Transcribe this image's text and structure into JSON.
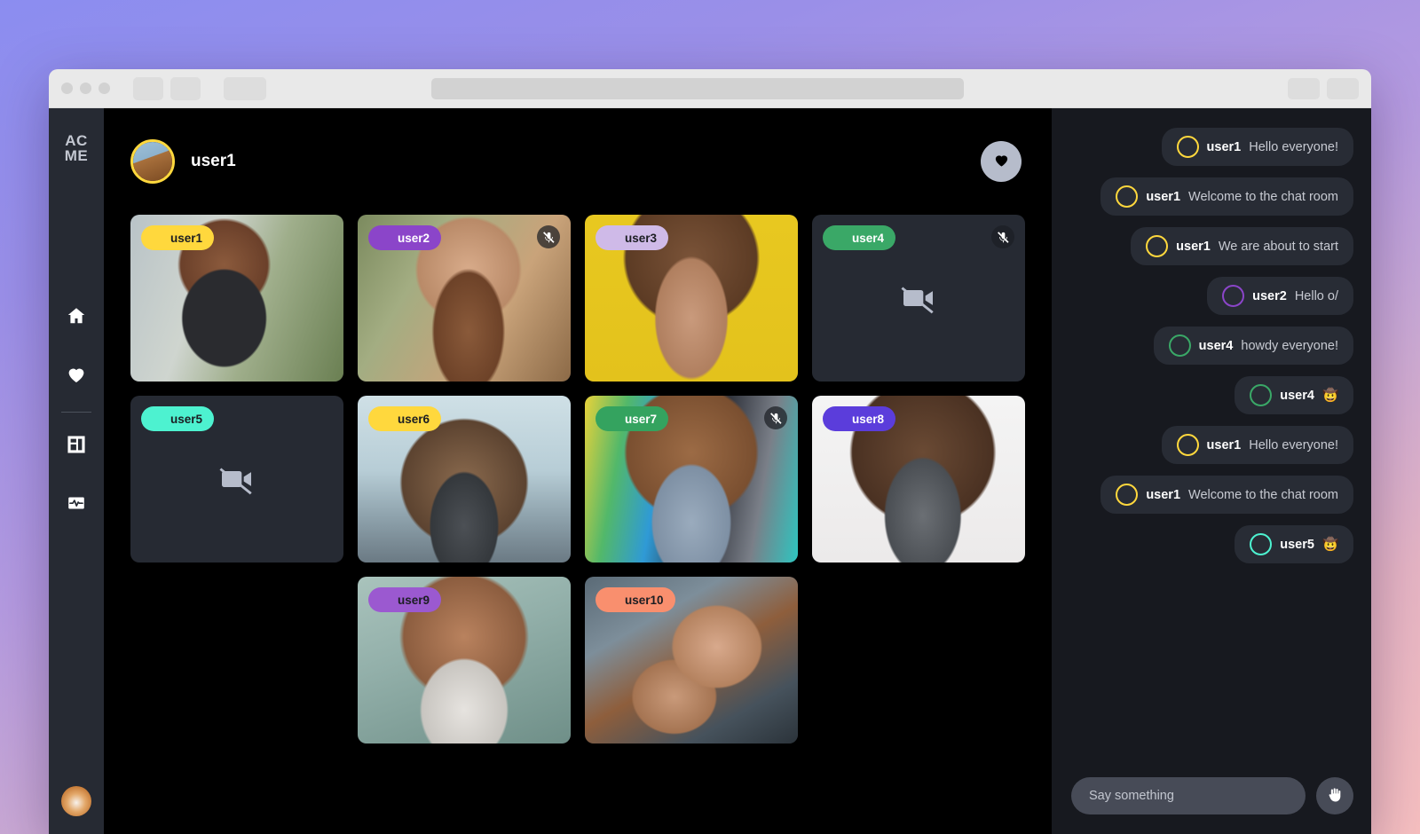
{
  "browser": {
    "dots": 3,
    "tabs": 3,
    "right_buttons": 2
  },
  "sidebar": {
    "logo_line1": "AC",
    "logo_line2": "ME",
    "items": [
      {
        "name": "home",
        "icon": "home-icon"
      },
      {
        "name": "favorites",
        "icon": "heart-icon"
      },
      {
        "name": "layout",
        "icon": "grid-layout-icon"
      },
      {
        "name": "activity",
        "icon": "activity-pulse-icon"
      }
    ],
    "avatar": {
      "alt": "shiba",
      "art": "av-shiba"
    }
  },
  "header": {
    "host_name": "user1",
    "host_avatar": {
      "art": "av-horse",
      "ring": "#ffd83d"
    },
    "action_icon": "heart-icon"
  },
  "tiles": [
    {
      "name": "user1",
      "badge_bg": "#ffd83d",
      "badge_fg": "#1b1d22",
      "avatar_art": "av-horse",
      "muted": false,
      "camera_off": false,
      "photo": "ph1"
    },
    {
      "name": "user2",
      "badge_bg": "#8b45c9",
      "badge_fg": "#ffffff",
      "avatar_art": "av-dog",
      "muted": true,
      "camera_off": false,
      "photo": "ph2"
    },
    {
      "name": "user3",
      "badge_bg": "#cfbae8",
      "badge_fg": "#1b1d22",
      "avatar_art": "av-horse2",
      "muted": false,
      "camera_off": false,
      "photo": "ph3"
    },
    {
      "name": "user4",
      "badge_bg": "#3aa867",
      "badge_fg": "#ffffff",
      "avatar_art": "av-parrot",
      "muted": true,
      "camera_off": true,
      "photo": ""
    },
    {
      "name": "user5",
      "badge_bg": "#4df2d0",
      "badge_fg": "#1b1d22",
      "avatar_art": "av-deer",
      "muted": false,
      "camera_off": true,
      "photo": ""
    },
    {
      "name": "user6",
      "badge_bg": "#ffd83d",
      "badge_fg": "#1b1d22",
      "avatar_art": "av-goat",
      "muted": false,
      "camera_off": false,
      "photo": "ph6"
    },
    {
      "name": "user7",
      "badge_bg": "#34a35f",
      "badge_fg": "#ffffff",
      "avatar_art": "av-shiba",
      "muted": true,
      "camera_off": false,
      "photo": "ph7"
    },
    {
      "name": "user8",
      "badge_bg": "#5b3ddb",
      "badge_fg": "#ffffff",
      "avatar_art": "av-shiba",
      "muted": false,
      "camera_off": false,
      "photo": "ph8"
    },
    {
      "name": "user9",
      "badge_bg": "#9b59d0",
      "badge_fg": "#1b1d22",
      "avatar_art": "av-bear",
      "muted": false,
      "camera_off": false,
      "photo": "ph9"
    },
    {
      "name": "user10",
      "badge_bg": "#f98f6e",
      "badge_fg": "#1b1d22",
      "avatar_art": "av-hedge",
      "muted": false,
      "camera_off": false,
      "photo": "ph10"
    }
  ],
  "chat": {
    "messages": [
      {
        "user": "user1",
        "text": "Hello everyone!",
        "avatar_art": "av-horse",
        "ring": "#ffd83d"
      },
      {
        "user": "user1",
        "text": "Welcome to the chat room",
        "avatar_art": "av-horse",
        "ring": "#ffd83d"
      },
      {
        "user": "user1",
        "text": "We are about to start",
        "avatar_art": "av-horse",
        "ring": "#ffd83d"
      },
      {
        "user": "user2",
        "text": "Hello o/",
        "avatar_art": "av-dog",
        "ring": "#8b45c9"
      },
      {
        "user": "user4",
        "text": "howdy everyone!",
        "avatar_art": "av-parrot",
        "ring": "#3aa867"
      },
      {
        "user": "user4",
        "text": "🤠",
        "avatar_art": "av-parrot",
        "ring": "#3aa867"
      },
      {
        "user": "user1",
        "text": "Hello everyone!",
        "avatar_art": "av-horse",
        "ring": "#ffd83d"
      },
      {
        "user": "user1",
        "text": "Welcome to the chat room",
        "avatar_art": "av-horse",
        "ring": "#ffd83d"
      },
      {
        "user": "user5",
        "text": "🤠",
        "avatar_art": "av-deer",
        "ring": "#4df2d0"
      }
    ],
    "input_placeholder": "Say something",
    "raise_hand_icon": "raised-hand-icon"
  },
  "colors": {
    "sidebar_bg": "#262a33",
    "stage_bg": "#000000",
    "chat_bg": "#17191f",
    "bubble_bg": "#282c35",
    "tile_placeholder_bg": "#262a33"
  }
}
